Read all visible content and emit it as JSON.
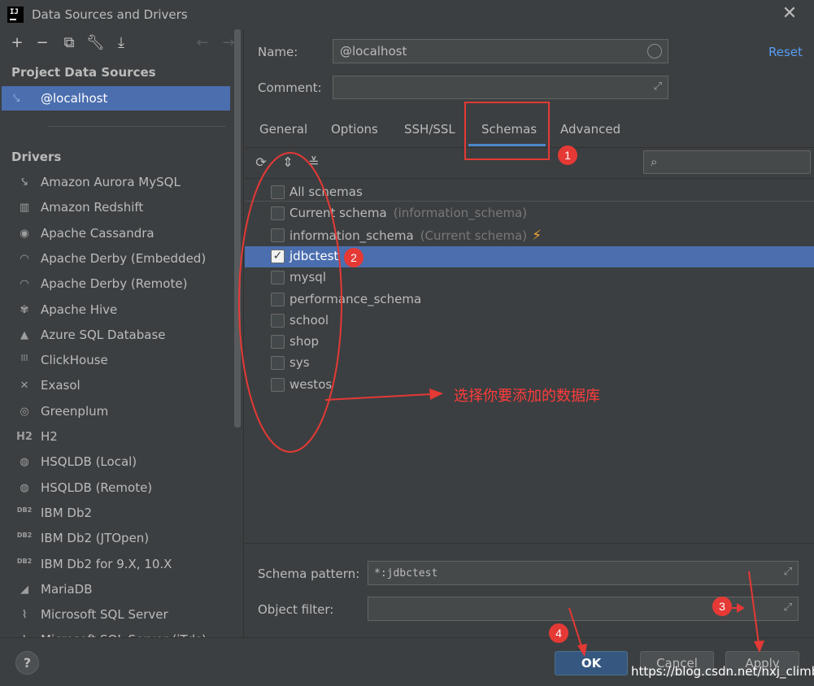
{
  "window": {
    "title": "Data Sources and Drivers",
    "logo_text": "IJ"
  },
  "left": {
    "toolbar_icons": [
      "add-icon",
      "remove-icon",
      "duplicate-icon",
      "wrench-icon",
      "import-icon",
      "back-icon",
      "forward-icon"
    ],
    "project_title": "Project Data Sources",
    "data_source": "@localhost",
    "drivers_title": "Drivers",
    "drivers": [
      {
        "label": "Amazon Aurora MySQL",
        "icon": "⤥"
      },
      {
        "label": "Amazon Redshift",
        "icon": "▥"
      },
      {
        "label": "Apache Cassandra",
        "icon": "◉"
      },
      {
        "label": "Apache Derby (Embedded)",
        "icon": "◠"
      },
      {
        "label": "Apache Derby (Remote)",
        "icon": "◠"
      },
      {
        "label": "Apache Hive",
        "icon": "✾"
      },
      {
        "label": "Azure SQL Database",
        "icon": "▲"
      },
      {
        "label": "ClickHouse",
        "icon": "|||"
      },
      {
        "label": "Exasol",
        "icon": "✕"
      },
      {
        "label": "Greenplum",
        "icon": "◎"
      },
      {
        "label": "H2",
        "icon": "H2"
      },
      {
        "label": "HSQLDB (Local)",
        "icon": "◍"
      },
      {
        "label": "HSQLDB (Remote)",
        "icon": "◍"
      },
      {
        "label": "IBM Db2",
        "icon": "DB2"
      },
      {
        "label": "IBM Db2 (JTOpen)",
        "icon": "DB2"
      },
      {
        "label": "IBM Db2 for 9.X, 10.X",
        "icon": "DB2"
      },
      {
        "label": "MariaDB",
        "icon": "◢"
      },
      {
        "label": "Microsoft SQL Server",
        "icon": "⌇"
      },
      {
        "label": "Microsoft SQL Server (jTds)",
        "icon": "⌇"
      }
    ]
  },
  "form": {
    "name_label": "Name:",
    "name_value": "@localhost",
    "comment_label": "Comment:",
    "comment_value": "",
    "reset_label": "Reset"
  },
  "tabs": [
    "General",
    "Options",
    "SSH/SSL",
    "Schemas",
    "Advanced"
  ],
  "active_tab": "Schemas",
  "schemas": {
    "toolbar_icons": [
      "refresh-icon",
      "expand-all-icon",
      "collapse-all-icon"
    ],
    "search_placeholder": "",
    "items": [
      {
        "label": "All schemas",
        "hint": "",
        "checked": false
      },
      {
        "label": "Current schema",
        "hint": "(information_schema)",
        "checked": false
      },
      {
        "label": "information_schema",
        "hint": "(Current schema)",
        "checked": false
      },
      {
        "label": "jdbctest",
        "hint": "",
        "checked": true
      },
      {
        "label": "mysql",
        "hint": "",
        "checked": false
      },
      {
        "label": "performance_schema",
        "hint": "",
        "checked": false
      },
      {
        "label": "school",
        "hint": "",
        "checked": false
      },
      {
        "label": "shop",
        "hint": "",
        "checked": false
      },
      {
        "label": "sys",
        "hint": "",
        "checked": false
      },
      {
        "label": "westos",
        "hint": "",
        "checked": false
      }
    ],
    "pattern_label": "Schema pattern:",
    "pattern_value": "*:jdbctest",
    "filter_label": "Object filter:",
    "filter_value": ""
  },
  "footer": {
    "help_label": "?",
    "ok_label": "OK",
    "cancel_label": "Cancel",
    "apply_label": "Apply",
    "watermark": "https://blog.csdn.net/nxj_climb"
  },
  "annotations": {
    "badges": [
      "1",
      "2",
      "3",
      "4"
    ],
    "note": "选择你要添加的数据库",
    "color": "#e53935"
  }
}
